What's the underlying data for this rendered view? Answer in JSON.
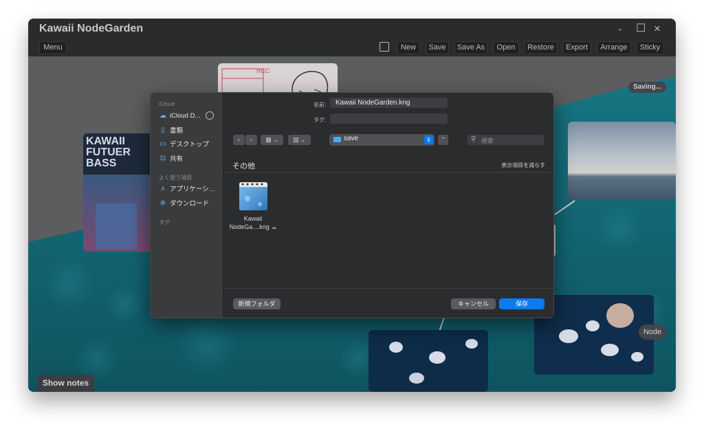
{
  "app": {
    "title": "Kawaii NodeGarden"
  },
  "window_controls": {
    "minimize": "-",
    "maximize": "☐",
    "close": "×"
  },
  "toolbar": {
    "menu": "Menu",
    "new": "New",
    "save": "Save",
    "save_as": "Save As",
    "open": "Open",
    "restore": "Restore",
    "export": "Export",
    "arrange": "Arrange",
    "sticky": "Sticky"
  },
  "canvas": {
    "saving_badge": "Saving...",
    "node_label": "Node",
    "show_notes": "Show notes",
    "album_text": [
      "KAWAII",
      "FUTUER",
      "BASS"
    ],
    "sketch_text": "REC"
  },
  "dialog": {
    "name_label": "名前:",
    "filename": "Kawaii NodeGarden.kng",
    "tags_label": "タグ:",
    "tags_value": "",
    "folder": "save",
    "search_placeholder": "検索",
    "section_title": "その他",
    "show_fewer": "表示項目を減らす",
    "file": {
      "line1": "Kawaii",
      "line2": "NodeGa....kng"
    },
    "new_folder": "新規フォルダ",
    "cancel": "キャンセル",
    "save": "保存",
    "sidebar": {
      "icloud_heading": "iCloud",
      "icloud_drive": "iCloud D...",
      "documents": "書類",
      "desktop": "デスクトップ",
      "shared": "共有",
      "favorites_heading": "よく使う項目",
      "applications": "アプリケーシ…",
      "downloads": "ダウンロード",
      "tags_heading": "タグ"
    }
  },
  "colors": {
    "accent_blue": "#0a7bf0",
    "teal_bg": "#12606e",
    "window_bg": "#28292b"
  }
}
